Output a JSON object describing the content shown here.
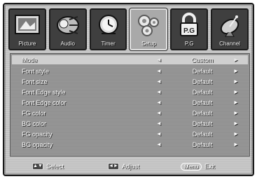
{
  "tabs": [
    {
      "label": "Picture",
      "icon": "picture-icon"
    },
    {
      "label": "Audio",
      "icon": "audio-icon"
    },
    {
      "label": "Timer",
      "icon": "timer-icon"
    },
    {
      "label": "Setup",
      "icon": "setup-icon",
      "active": true
    },
    {
      "label": "P.G",
      "icon": "parental-lock-icon"
    },
    {
      "label": "Channel",
      "icon": "channel-icon"
    }
  ],
  "rows": [
    {
      "label": "Mode",
      "value": "Custom",
      "arrow_left": "◄",
      "arrow_right": "►"
    },
    {
      "label": "Font style",
      "value": "Default",
      "arrow_left": "◄",
      "arrow_right": "►"
    },
    {
      "label": "Font size",
      "value": "Default",
      "arrow_left": "◄",
      "arrow_right": "►"
    },
    {
      "label": "Font Edge style",
      "value": "Default",
      "arrow_left": "◄",
      "arrow_right": "►"
    },
    {
      "label": "Font Edge color",
      "value": "Default",
      "arrow_left": "◄",
      "arrow_right": "►"
    },
    {
      "label": "FG color",
      "value": "Default",
      "arrow_left": "◄",
      "arrow_right": "►"
    },
    {
      "label": "BG color",
      "value": "Default",
      "arrow_left": "◄",
      "arrow_right": "►"
    },
    {
      "label": "FG opacity",
      "value": "Default",
      "arrow_left": "◄",
      "arrow_right": "►"
    },
    {
      "label": "BG opacity",
      "value": "Default",
      "arrow_left": "◄",
      "arrow_right": "►"
    }
  ],
  "footer": {
    "select_label": "Select",
    "adjust_label": "Adjust",
    "menu_key": "Menu",
    "exit_label": "Exit",
    "select_icon": "up-down-arrows-icon",
    "adjust_icon": "left-right-arrows-icon"
  },
  "colors": {
    "panel": "#c9c9c9",
    "list_bg": "#8f8f8f",
    "selected_row": "#cfcfcf",
    "tab_bg": "#3f3f3f",
    "tab_active": "#a9a9a9"
  }
}
